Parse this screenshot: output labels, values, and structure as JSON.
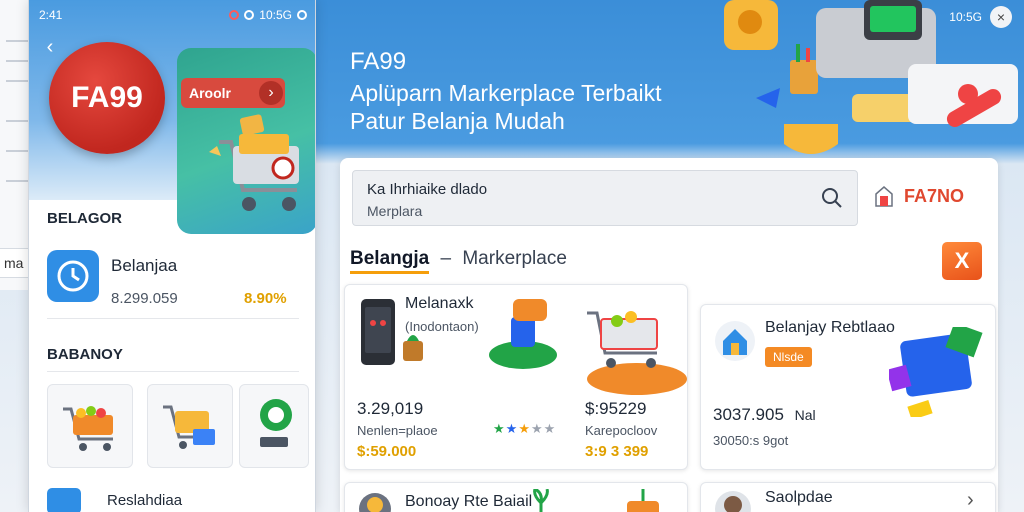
{
  "colors": {
    "hero_blue": "#3b8ed8",
    "brand_red": "#c1271f",
    "accent_orange": "#f48a24",
    "promo_gold": "#e0a000",
    "tab_underline": "#f59e0b"
  },
  "background": {
    "side_label": "ma"
  },
  "phone": {
    "status_time": "2:41",
    "status_right": "10:5G",
    "brand": "FA99",
    "promo_label": "Aroolr",
    "section_1": "BELAGOR",
    "app": {
      "name": "Belanjaa",
      "price": "8.299.059",
      "discount": "8.90%"
    },
    "section_2": "BABANOY",
    "bottom_label": "Reslahdiaa"
  },
  "hero": {
    "title": "FA99",
    "subtitle_1": "Aplüparn Markerplace Terbaikt",
    "subtitle_2": "Patur Belanja Mudah"
  },
  "top_right": {
    "status": "10:5G"
  },
  "search": {
    "value": "Ka Ihrhiaike dlado",
    "placeholder": "Merplara"
  },
  "brand_chip": {
    "label": "FA7NO"
  },
  "tabs": {
    "active": "Belangja",
    "separator": "–",
    "rest": "Markerplace"
  },
  "products": [
    {
      "name": "Melanaxk",
      "sub": "(Inodontaon)",
      "price": "3.29,019",
      "category": "Nenlen=plaoe",
      "promo": "$:59.000"
    },
    {
      "price": "$:95229",
      "category": "Karepocloov",
      "promo": "3:9 3 399"
    },
    {
      "name": "Belanjay Rebtlaao",
      "badge": "Nlsde",
      "price": "3037.905",
      "price_suffix": "Nal",
      "category": "30050:s 9got"
    },
    {
      "name": "Bonoay Rte Baiail"
    },
    {
      "name": "Saolpdae"
    }
  ]
}
